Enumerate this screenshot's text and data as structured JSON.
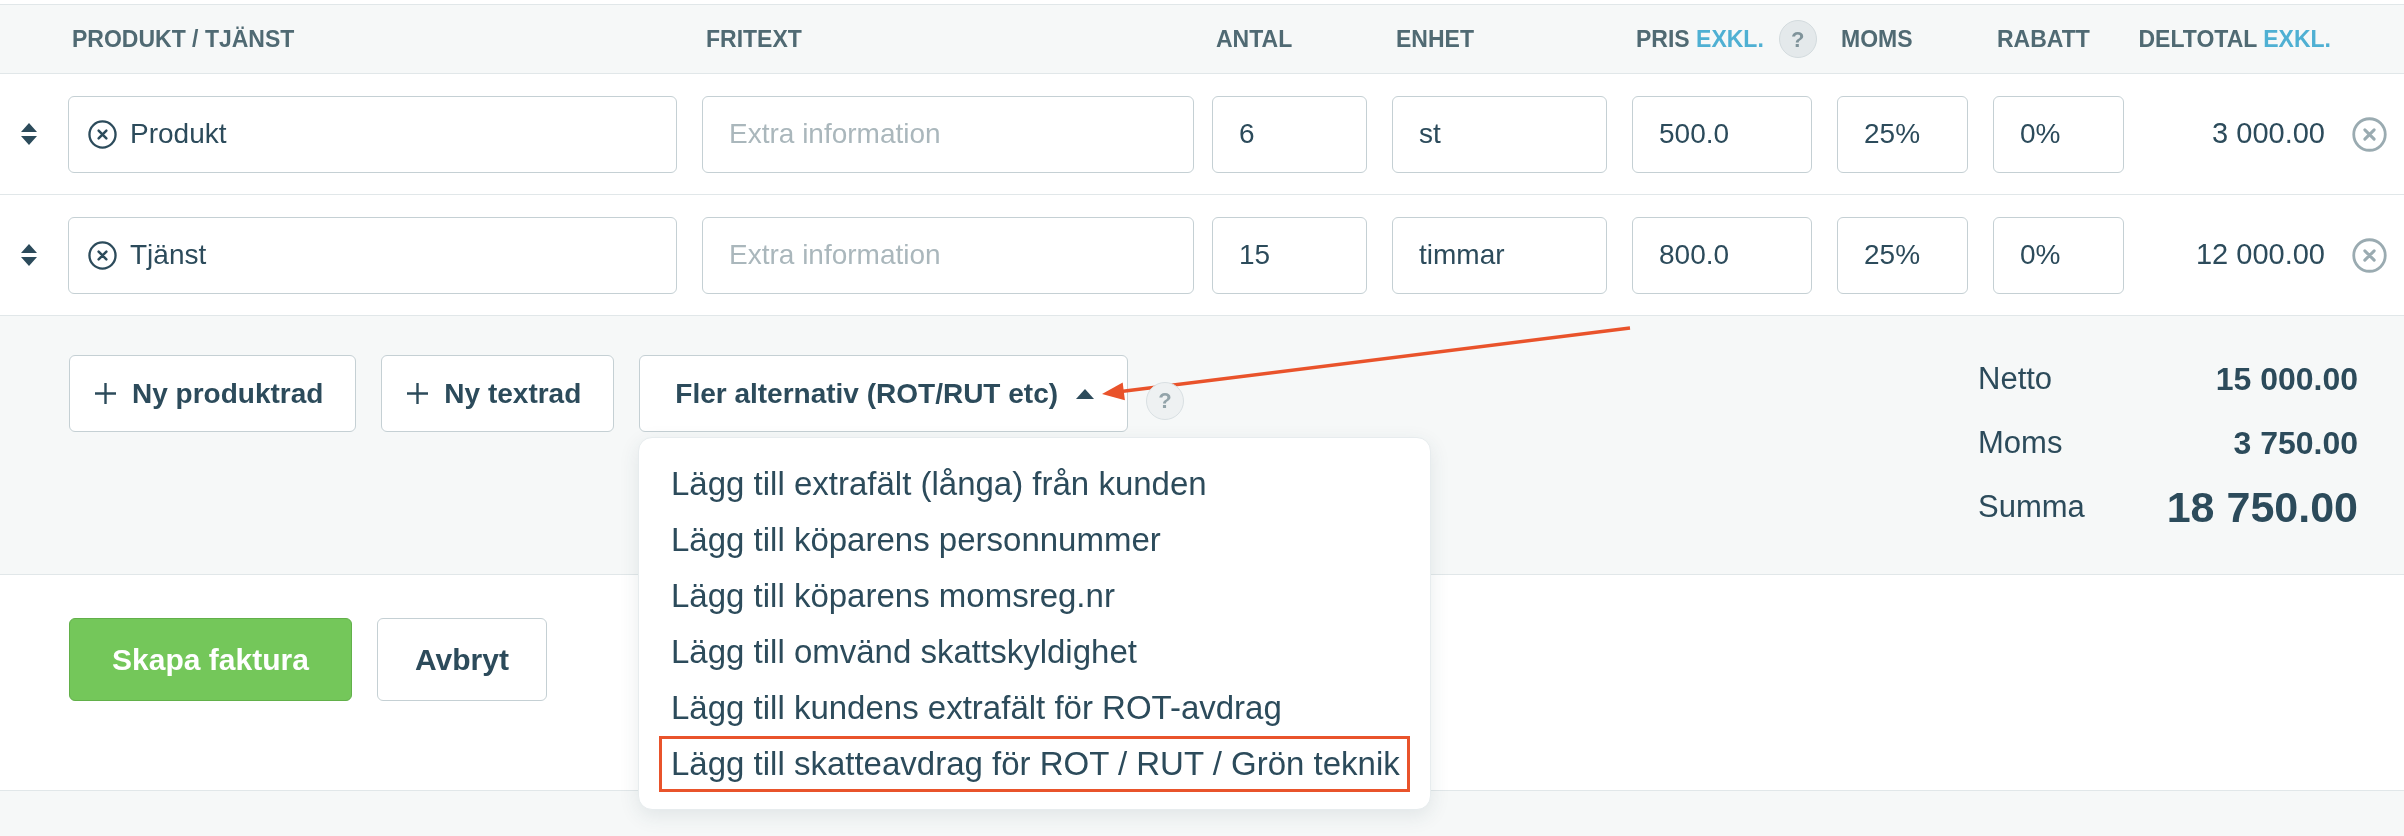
{
  "table": {
    "columns": [
      {
        "label": "PRODUKT / TJÄNST"
      },
      {
        "label": "FRITEXT"
      },
      {
        "label": "ANTAL"
      },
      {
        "label": "ENHET"
      },
      {
        "label": "PRIS",
        "suffix": "EXKL.",
        "help": "?"
      },
      {
        "label": "MOMS"
      },
      {
        "label": "RABATT"
      },
      {
        "label": "DELTOTAL",
        "suffix": "EXKL."
      }
    ],
    "rows": [
      {
        "product": "Produkt",
        "fritext": {
          "placeholder": "Extra information"
        },
        "antal": "6",
        "enhet": "st",
        "pris": "500.0",
        "moms": "25%",
        "rabatt": "0%",
        "deltotal": "3 000.00"
      },
      {
        "product": "Tjänst",
        "fritext": {
          "placeholder": "Extra information"
        },
        "antal": "15",
        "enhet": "timmar",
        "pris": "800.0",
        "moms": "25%",
        "rabatt": "0%",
        "deltotal": "12 000.00"
      }
    ]
  },
  "actions": {
    "buttons": [
      {
        "kind": "add",
        "label": "Ny produktrad",
        "annotated": false
      },
      {
        "kind": "add",
        "label": "Ny textrad",
        "annotated": false
      },
      {
        "kind": "dropdown",
        "label": "Fler alternativ (ROT/RUT etc)",
        "expanded": true,
        "annotated": true
      }
    ],
    "help": "?"
  },
  "dropdown_menu": {
    "items": [
      {
        "label": "Lägg till extrafält (långa) från kunden",
        "annotated": false
      },
      {
        "label": "Lägg till köparens personnummer",
        "annotated": false
      },
      {
        "label": "Lägg till köparens momsreg.nr",
        "annotated": false
      },
      {
        "label": "Lägg till omvänd skattskyldighet",
        "annotated": false
      },
      {
        "label": "Lägg till kundens extrafält för ROT-avdrag",
        "annotated": false
      },
      {
        "label": "Lägg till skatteavdrag för ROT / RUT / Grön teknik",
        "annotated": true
      }
    ]
  },
  "totals": [
    {
      "kind": "normal",
      "label": "Netto",
      "value": "15 000.00"
    },
    {
      "kind": "normal",
      "label": "Moms",
      "value": "3 750.00"
    },
    {
      "kind": "grand",
      "label": "Summa",
      "value": "18 750.00"
    }
  ],
  "form_buttons": [
    {
      "kind": "primary",
      "label": "Skapa faktura"
    },
    {
      "kind": "secondary",
      "label": "Avbryt"
    }
  ]
}
